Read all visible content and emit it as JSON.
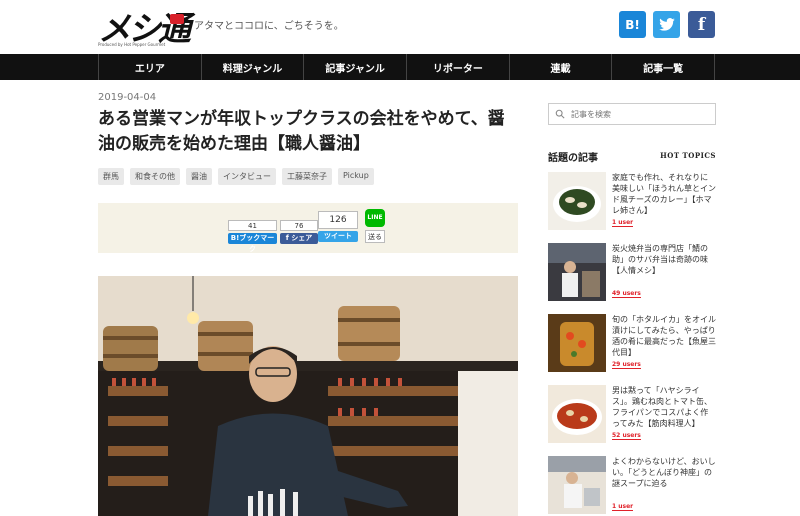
{
  "header": {
    "logo_text": "メシ通",
    "logo_sub": "Produced by Hot Pepper Gourmet",
    "tagline": "アタマとココロに、ごちそうを。",
    "social": [
      {
        "name": "hatena-bookmark",
        "label": "B!",
        "color": "#1a86d8"
      },
      {
        "name": "twitter",
        "label": "🐦",
        "color": "#35a4e8"
      },
      {
        "name": "facebook",
        "label": "f",
        "color": "#3b5b98"
      }
    ]
  },
  "nav": {
    "items": [
      "エリア",
      "料理ジャンル",
      "記事ジャンル",
      "リポーター",
      "連載",
      "記事一覧"
    ]
  },
  "article": {
    "date": "2019-04-04",
    "title": "ある営業マンが年収トップクラスの会社をやめて、醤油の販売を始めた理由【職人醤油】",
    "tags": [
      "群馬",
      "和食その他",
      "醤油",
      "インタビュー",
      "工藤菜奈子",
      "Pickup"
    ]
  },
  "share": {
    "hatena_count": "41",
    "hatena_label": "B!ブックマーク",
    "facebook_count": "76",
    "facebook_label": "f シェア",
    "tweet_count": "126",
    "tweet_label": "ツイート",
    "line_icon": "LINE",
    "line_label": "送る"
  },
  "sidebar": {
    "search_placeholder": "記事を検索",
    "hot_title": "話題の記事",
    "hot_subtitle": "HOT TOPICS",
    "items": [
      {
        "text": "家庭でも作れ、それなりに美味しい「ほうれん草とインド風チーズのカレー」【ホマレ姉さん】",
        "users": "1 user"
      },
      {
        "text": "炭火焼弁当の専門店「鯖の助」のサバ弁当は奇跡の味【人情メシ】",
        "users": "49 users"
      },
      {
        "text": "旬の「ホタルイカ」をオイル漬けにしてみたら、やっぱり酒の肴に最高だった【魚屋三代目】",
        "users": "29 users"
      },
      {
        "text": "男は黙って「ハヤシライス」。鶏むね肉とトマト缶、フライパンでコスパよく作ってみた【筋肉料理人】",
        "users": "52 users"
      },
      {
        "text": "よくわからないけど、おいしい。「どうとんぼり神座」の謎スープに迫る",
        "users": "1 user"
      }
    ]
  }
}
